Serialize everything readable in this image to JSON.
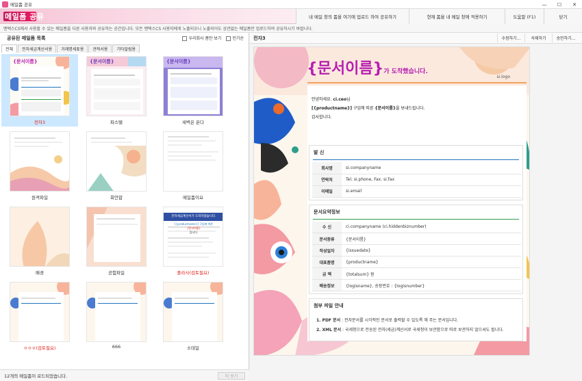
{
  "window": {
    "title": "메일폼 공유",
    "controls": [
      "—",
      "☐",
      "✕"
    ]
  },
  "header": {
    "title": "메일폼 공유",
    "buttons": [
      "내 메일 창의 폼을 여기에 업로드 하여 공유하기",
      "현재 폼을 내 메일 창에 적용하기",
      "도움말 (F1)",
      "닫기"
    ]
  },
  "notice": "멘텍스CS에서 사용할 수 있는 메일폼을 다른 사용자와 공유하는 공간입니다. 모든 멘텍스CS 사용자에게 노출되오니 노출되어도 상관없는 메일폼만 업로드하여 공유하시기 바랍니다.",
  "left": {
    "heading": "공유된 메일폼 목록",
    "options": [
      "우리회사 폼만 보기",
      "인기순"
    ],
    "tabs": [
      "전체",
      "전자세금계산서용",
      "거래명세표용",
      "견적서용",
      "기타알림용"
    ],
    "items": [
      {
        "label": "전자3",
        "style": "red"
      },
      {
        "label": "파스텔",
        "style": "normal"
      },
      {
        "label": "새벽은 온다",
        "style": "normal"
      },
      {
        "label": "원격파일",
        "style": "normal"
      },
      {
        "label": "회안합",
        "style": "normal"
      },
      {
        "label": "메일폼이요",
        "style": "normal"
      },
      {
        "label": "배경",
        "style": "normal"
      },
      {
        "label": "공험파일",
        "style": "normal"
      },
      {
        "label": "폴라사(검토필요)",
        "style": "red"
      },
      {
        "label": "ㅇㅇㅇ(검토필요)",
        "style": "red"
      },
      {
        "label": "666",
        "style": "normal"
      },
      {
        "label": "소데일",
        "style": "normal"
      }
    ],
    "thumb_texts": {
      "t1": "{문서이름}",
      "t2": "{문서이름}",
      "t3": "{문서이름}",
      "t9_title": "전자세금계산서가 도착하였습니다.",
      "t9_sub": "[{productname}] 구입에 따른",
      "t9_sub2": "{문서이름}",
      "t9_sub3": "입니다."
    },
    "status": "12개의 메일폼이 로드되었습니다.",
    "view_button": "미 보기"
  },
  "right": {
    "name": "전자3",
    "buttons": [
      "수정하기...",
      "삭제하기",
      "승인하기..."
    ],
    "preview": {
      "title": "{문서이름}",
      "title_suffix": "가 도착했습니다.",
      "logo": "si.logo",
      "greeting1_pre": "안녕하세요. ",
      "greeting1_bold": "ci.ceo",
      "greeting1_post": "님",
      "greeting2_bold": "[{productname}]",
      "greeting2_mid": " 구입에 따른 ",
      "greeting2_doc": "{문서이름}",
      "greeting2_post": "을 보내드립니다.",
      "greeting3": "감사합니다.",
      "sender_title": "발 신",
      "sender_rows": [
        {
          "k": "회사명",
          "v": "si.companyname"
        },
        {
          "k": "연락처",
          "v": "Tel. si.phone, Fax. si.fax"
        },
        {
          "k": "이메일",
          "v": "si.email"
        }
      ],
      "summary_title": "문서요약정보",
      "summary_rows": [
        {
          "k": "수    신",
          "v": "ci.companyname (ci.hiddenbiznumber)"
        },
        {
          "k": "문서종류",
          "v": "{문서이름}"
        },
        {
          "k": "작성일자",
          "v": "{issuedate}"
        },
        {
          "k": "대표품명",
          "v": "{productname}"
        },
        {
          "k": "금    액",
          "v": "{totalsum} 원"
        },
        {
          "k": "배송정보",
          "v": "{logisname}, 송장번호 : {logisnumber}"
        }
      ],
      "attach_title": "첨부 파일 안내",
      "attach_lines": [
        {
          "b": "1. PDF 문서",
          "t": " : 전자문서를 시각적인 문서로 출력할 수 있도록 해 주는 문서입니다."
        },
        {
          "b": "2. XML 문서",
          "t": " : 국세청으로 전송된 전자(세금)계산서로 국세청이 보관함으로 따로 보관하지 않으셔도 됩니다."
        }
      ]
    }
  },
  "colors": {
    "accent_pink": "#e91e63",
    "title_purple": "#b71fb0",
    "selected_bg": "#cce8ff",
    "red_label": "#e0231c",
    "section_blue": "#1e73be",
    "section_green": "#2e9e4a"
  }
}
